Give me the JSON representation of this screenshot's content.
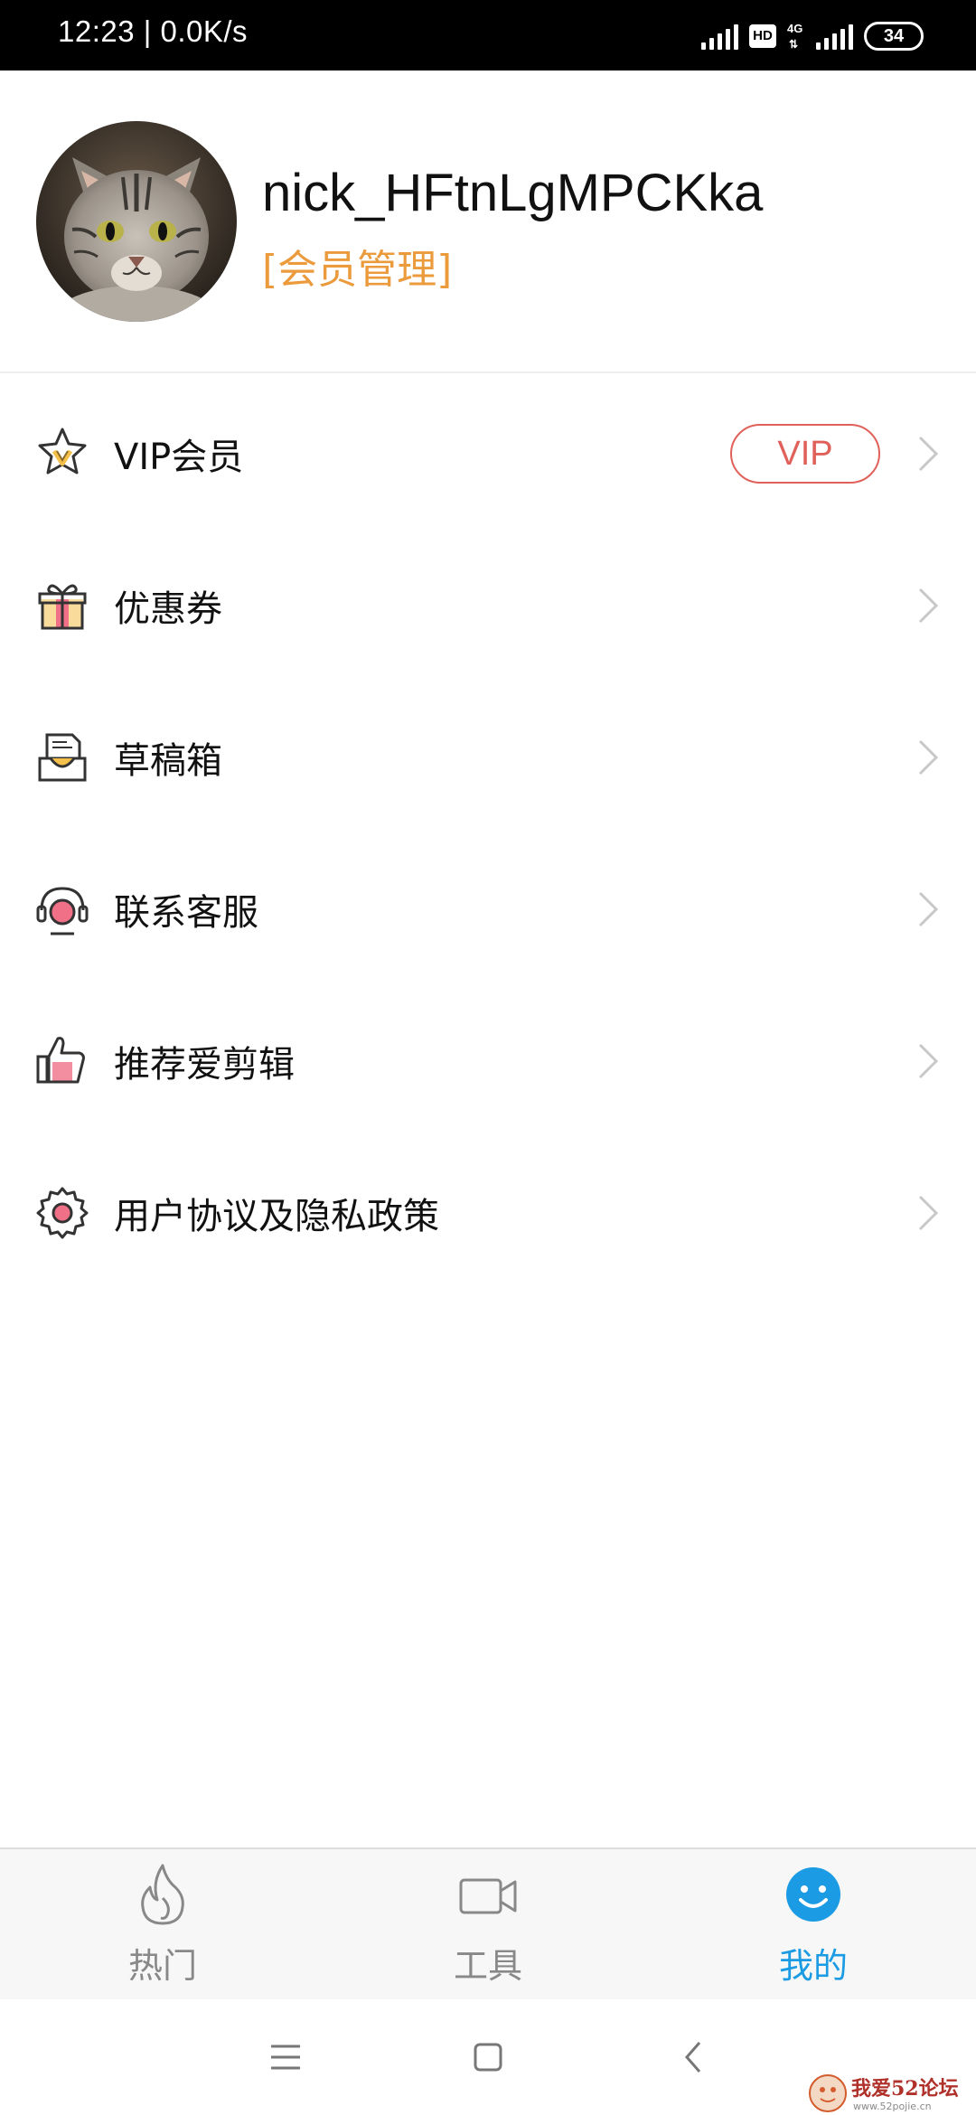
{
  "status_bar": {
    "time": "12:23 | 0.0K/s",
    "hd": "HD",
    "network": "4G",
    "battery": "34"
  },
  "profile": {
    "username": "nick_HFtnLgMPCKka",
    "member_link": "[会员管理]"
  },
  "menu": {
    "items": [
      {
        "label": "VIP会员",
        "icon": "vip-star-icon",
        "badge": "VIP"
      },
      {
        "label": "优惠券",
        "icon": "gift-icon"
      },
      {
        "label": "草稿箱",
        "icon": "draft-box-icon"
      },
      {
        "label": "联系客服",
        "icon": "headset-icon"
      },
      {
        "label": "推荐爱剪辑",
        "icon": "thumbs-up-icon"
      },
      {
        "label": "用户协议及隐私政策",
        "icon": "settings-gear-icon"
      }
    ]
  },
  "tabs": [
    {
      "label": "热门",
      "icon": "flame-icon",
      "active": false
    },
    {
      "label": "工具",
      "icon": "video-camera-icon",
      "active": false
    },
    {
      "label": "我的",
      "icon": "smiley-icon",
      "active": true
    }
  ],
  "colors": {
    "accent": "#1a9be3",
    "member_orange": "#eb9a3c",
    "vip_red": "#e0605a",
    "icon_pink": "#f07088",
    "icon_yellow": "#f4c04a"
  },
  "watermark": "我爱52论坛"
}
